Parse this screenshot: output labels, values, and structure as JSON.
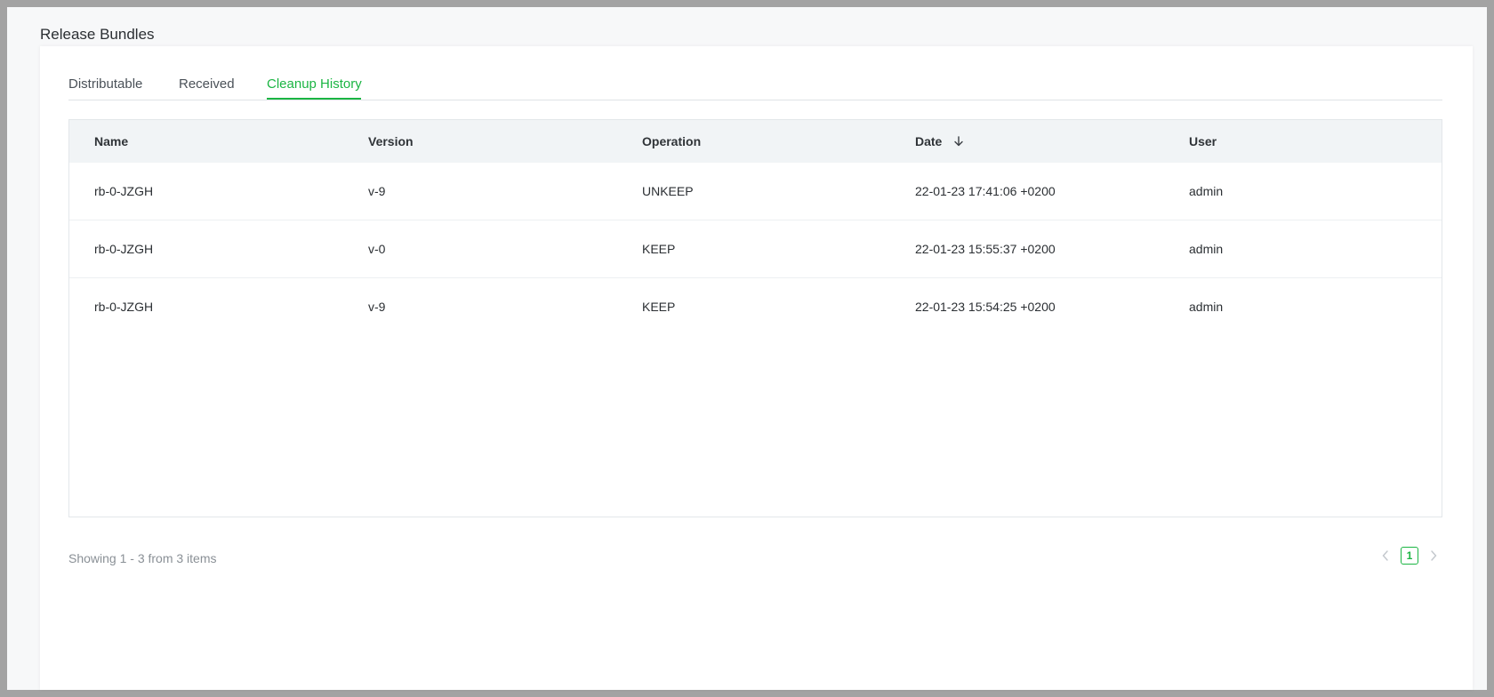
{
  "page": {
    "title": "Release Bundles"
  },
  "tabs": [
    {
      "label": "Distributable"
    },
    {
      "label": "Received"
    },
    {
      "label": "Cleanup History"
    }
  ],
  "active_tab": "Cleanup History",
  "table": {
    "headers": {
      "name": "Name",
      "version": "Version",
      "operation": "Operation",
      "date": "Date",
      "user": "User"
    },
    "sort": {
      "column": "Date",
      "direction": "descending",
      "icon": "arrow-down-icon"
    },
    "rows": [
      {
        "name": "rb-0-JZGH",
        "version": "v-9",
        "operation": "UNKEEP",
        "date": "22-01-23 17:41:06 +0200",
        "user": "admin"
      },
      {
        "name": "rb-0-JZGH",
        "version": "v-0",
        "operation": "KEEP",
        "date": "22-01-23 15:55:37 +0200",
        "user": "admin"
      },
      {
        "name": "rb-0-JZGH",
        "version": "v-9",
        "operation": "KEEP",
        "date": "22-01-23 15:54:25 +0200",
        "user": "admin"
      }
    ]
  },
  "footer": {
    "showing_text": "Showing 1 - 3 from 3 items"
  },
  "pagination": {
    "current_page": "1",
    "prev_icon": "chevron-left-icon",
    "next_icon": "chevron-right-icon"
  },
  "colors": {
    "accent": "#1bb543",
    "header_bg": "#f1f4f6",
    "muted_text": "#8a9096"
  }
}
